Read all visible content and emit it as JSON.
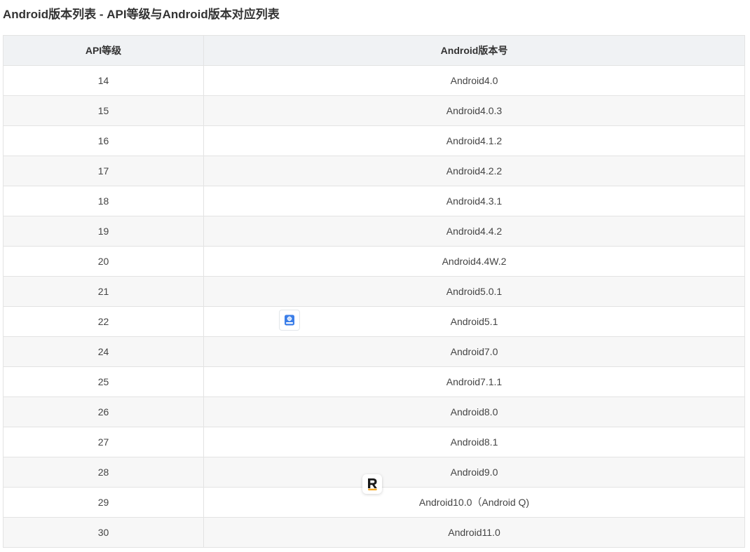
{
  "page": {
    "title": "Android版本列表 - API等级与Android版本对应列表"
  },
  "table": {
    "headers": [
      "API等级",
      "Android版本号"
    ],
    "rows": [
      {
        "api": "14",
        "version": "Android4.0"
      },
      {
        "api": "15",
        "version": "Android4.0.3"
      },
      {
        "api": "16",
        "version": "Android4.1.2"
      },
      {
        "api": "17",
        "version": "Android4.2.2"
      },
      {
        "api": "18",
        "version": "Android4.3.1"
      },
      {
        "api": "19",
        "version": "Android4.4.2"
      },
      {
        "api": "20",
        "version": "Android4.4W.2"
      },
      {
        "api": "21",
        "version": "Android5.0.1"
      },
      {
        "api": "22",
        "version": "Android5.1"
      },
      {
        "api": "24",
        "version": "Android7.0"
      },
      {
        "api": "25",
        "version": "Android7.1.1"
      },
      {
        "api": "26",
        "version": "Android8.0"
      },
      {
        "api": "27",
        "version": "Android8.1"
      },
      {
        "api": "28",
        "version": "Android9.0"
      },
      {
        "api": "29",
        "version": "Android10.0（Android Q)"
      },
      {
        "api": "30",
        "version": "Android11.0"
      }
    ]
  },
  "overlays": {
    "blue_icon": "book-scan-icon",
    "r_icon": "r-logo-icon"
  },
  "colors": {
    "header_bg": "#f0f2f4",
    "stripe_bg": "#f7f7f7",
    "border": "#e3e3e3",
    "icon_blue": "#3b7ee8",
    "icon_r_accent": "#f5a623"
  }
}
